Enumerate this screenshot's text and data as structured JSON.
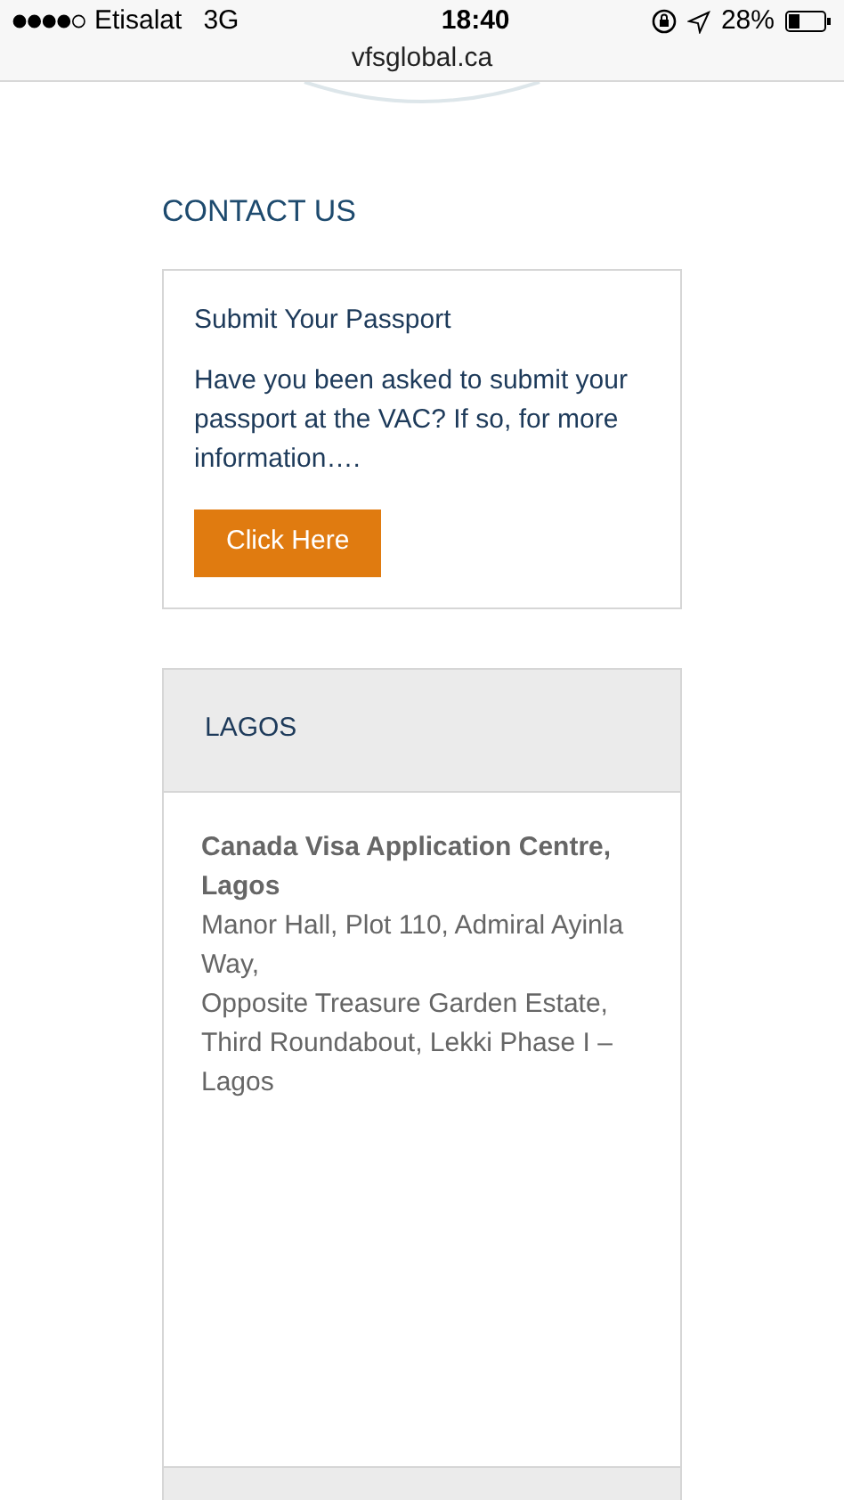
{
  "status_bar": {
    "carrier": "Etisalat",
    "network": "3G",
    "time": "18:40",
    "battery": "28%"
  },
  "address_bar": {
    "url": "vfsglobal.ca"
  },
  "section_title": "CONTACT US",
  "passport_card": {
    "title": "Submit Your Passport",
    "text": "Have you been asked to submit your passport at the VAC? If so, for more information….",
    "button": "Click Here"
  },
  "office": {
    "header": "LAGOS",
    "name": "Canada Visa Application Centre, Lagos",
    "address_lines": [
      "Manor Hall, Plot 110, Admiral Ayinla Way,",
      "Opposite Treasure Garden Estate, Third Roundabout, Lekki Phase I – Lagos"
    ]
  }
}
